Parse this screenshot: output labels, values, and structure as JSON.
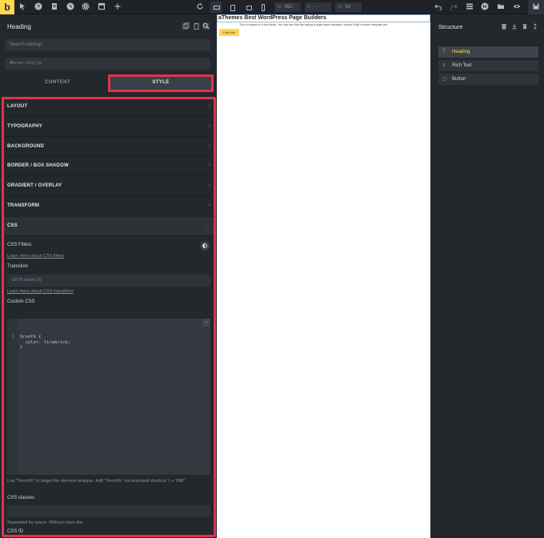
{
  "colors": {
    "accent": "#ffd64f",
    "highlight": "#e0344b",
    "panel": "#23282d",
    "topbar": "#1f2327"
  },
  "topbar": {
    "logo": "b",
    "icons": [
      "pointer-icon",
      "help-icon",
      "pages-icon",
      "history-icon",
      "settings-icon",
      "templates-icon",
      "add-icon",
      "refresh-icon"
    ],
    "width_label": "W",
    "width_value": "992",
    "height_label": "H",
    "height_value": "-",
    "zoom_label": "%",
    "zoom_value": "54"
  },
  "left_panel": {
    "title": "Heading",
    "search_placeholder": "Search settings",
    "element_id": "#brxe-tdijjm",
    "tabs": {
      "content": "CONTENT",
      "style": "STYLE"
    },
    "sections": [
      "LAYOUT",
      "TYPOGRAPHY",
      "BACKGROUND",
      "BORDER / BOX SHADOW",
      "GRADIENT / OVERLAY",
      "TRANSFORM",
      "CSS"
    ],
    "css": {
      "filters_label": "CSS Filters",
      "filters_link": "Learn more about CSS filters",
      "transition_label": "Transition",
      "transition_placeholder": "all 0s ease 0s",
      "transition_link": "Learn more about CSS transitions",
      "custom_css_label": "Custom CSS",
      "code_line_number": "1",
      "code": "%root% {\n  color: firebrick;\n}",
      "help_text": "Use \"%root%\" to target the element wrapper. Add \"%root%\" via keyboard shortcut \"r + TAB\".",
      "classes_label": "CSS classes",
      "classes_help": "Separated by space. Without class dot.",
      "css_id_label": "CSS ID"
    }
  },
  "canvas": {
    "heading": "aThemes Best WordPress Page Builders",
    "text": "This is content in a text block. You can see that the styling is quite basic because I haven't built a theme template yet.",
    "button": "Click Me"
  },
  "structure": {
    "title": "Structure",
    "items": [
      {
        "label": "Heading",
        "icon": "T"
      },
      {
        "label": "Rich Text",
        "icon": "≡"
      },
      {
        "label": "Button",
        "icon": "▢"
      }
    ]
  }
}
